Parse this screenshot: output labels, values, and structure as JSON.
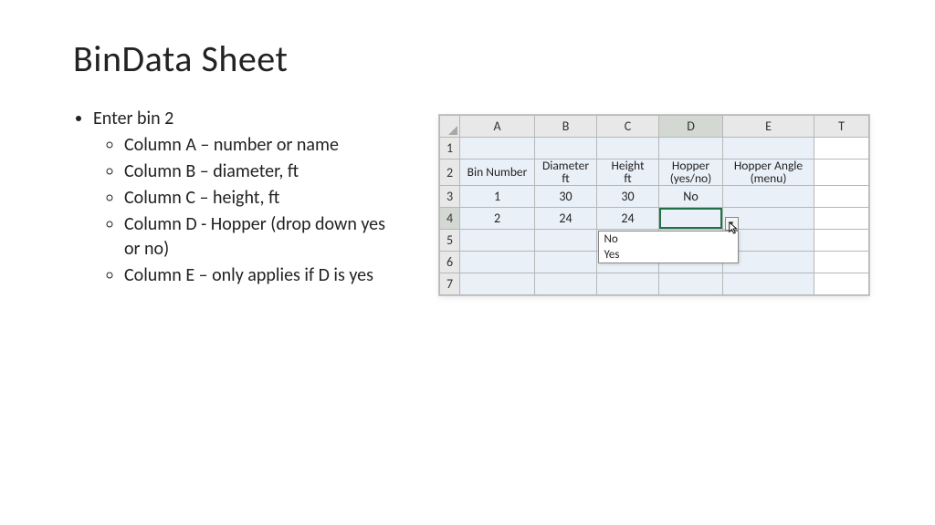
{
  "title": "BinData Sheet",
  "bullets": {
    "main": "Enter bin 2",
    "subs": [
      "Column A – number or name",
      "Column B – diameter, ft",
      "Column C – height, ft",
      "Column D - Hopper (drop down yes or no)",
      "Column E – only applies if D is yes"
    ]
  },
  "sheet": {
    "cols": [
      "A",
      "B",
      "C",
      "D",
      "E",
      "T"
    ],
    "rows": [
      "1",
      "2",
      "3",
      "4",
      "5",
      "6",
      "7"
    ],
    "selected_col": "D",
    "selected_row": "4",
    "headers": {
      "A": "Bin Number",
      "B": "Diameter\nft",
      "C": "Height\nft",
      "D": "Hopper\n(yes/no)",
      "E": "Hopper Angle\n(menu)"
    },
    "data": {
      "r3": {
        "A": "1",
        "B": "30",
        "C": "30",
        "D": "No",
        "E": ""
      },
      "r4": {
        "A": "2",
        "B": "24",
        "C": "24",
        "D": "",
        "E": ""
      }
    },
    "dropdown": {
      "options": [
        "No",
        "Yes"
      ]
    }
  }
}
